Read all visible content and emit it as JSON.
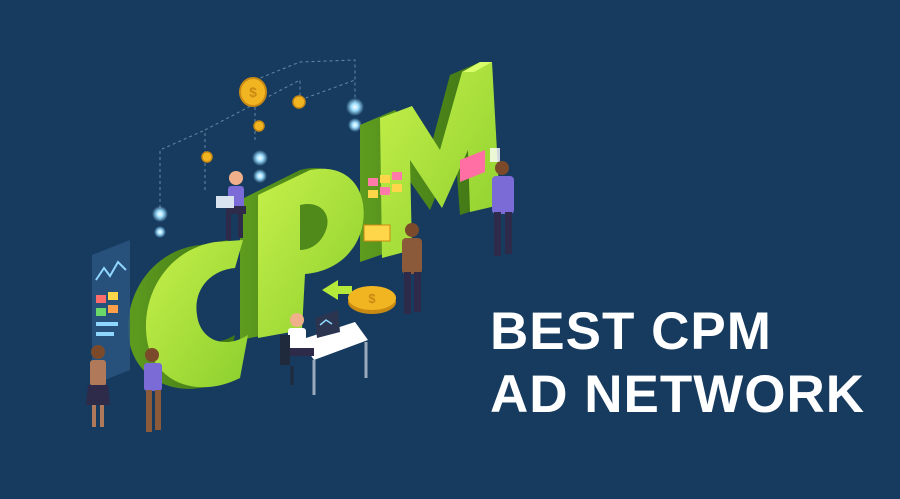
{
  "illustration": {
    "letters": [
      "C",
      "P",
      "M"
    ],
    "coin_symbol": "$",
    "colors": {
      "background": "#163b5f",
      "letter_light": "#b6ea3a",
      "letter_mid": "#84c92a",
      "letter_dark": "#4f8a1a",
      "coin": "#f2b522",
      "person_shirt": "#7a6bd6",
      "person_pants": "#2d2a4a",
      "glow": "#8fd6ff"
    },
    "icons": [
      "coin-icon",
      "laptop-icon",
      "arrow-icon",
      "card-icon",
      "chart-icon"
    ]
  },
  "headline": {
    "line1": "BEST CPM",
    "line2": "AD NETWORK"
  }
}
